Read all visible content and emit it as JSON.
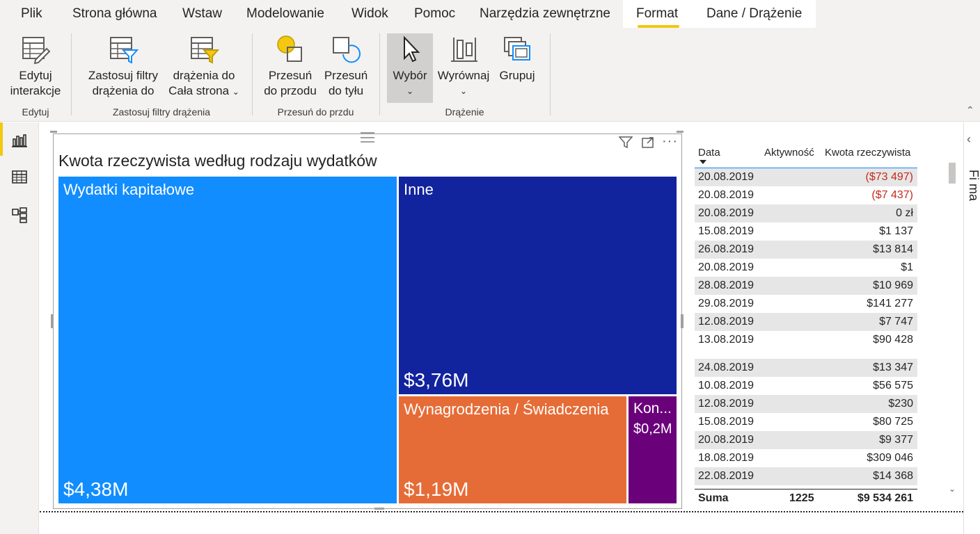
{
  "menu": {
    "tabs": [
      "Plik",
      "Strona główna",
      "Wstaw",
      "Modelowanie",
      "Widok",
      "Pomoc",
      "Narzędzia zewnętrzne",
      "Format",
      "Dane / Drążenie"
    ],
    "active": "Format"
  },
  "ribbon": {
    "edit_interactions": [
      "Edytuj",
      "interakcje"
    ],
    "apply_filters": [
      "Zastosuj filtry",
      "drążenia do"
    ],
    "drill_whole_page": [
      "drążenia do",
      "Cała strona"
    ],
    "bring_forward": [
      "Przesuń",
      "do przodu"
    ],
    "send_backward": [
      "Przesuń",
      "do tyłu"
    ],
    "selection": "Wybór",
    "align": "Wyrównaj",
    "group": "Grupuj",
    "groups": {
      "edit": "Edytuj",
      "apply_drill_filters": "Zastosuj filtry drążenia",
      "move": "Przesuń do przdu",
      "drill": "Drążenie"
    }
  },
  "treemap": {
    "title": "Kwota rzeczywista według rodzaju wydatków",
    "tiles": [
      {
        "label": "Wydatki kapitałowe",
        "value": "$4,38M",
        "color": "#118dff"
      },
      {
        "label": "Inne",
        "value": "$3,76M",
        "color": "#12239e"
      },
      {
        "label": "Wynagrodzenia / Świadczenia",
        "value": "$1,19M",
        "color": "#e66c37"
      },
      {
        "label": "Kon...",
        "value": "$0,2M",
        "color": "#6b007b"
      }
    ]
  },
  "table": {
    "headers": {
      "date": "Data",
      "activity": "Aktywność",
      "amount": "Kwota rzeczywista"
    },
    "rows": [
      {
        "date": "20.08.2019",
        "amount": "($73 497)",
        "negative": true
      },
      {
        "date": "20.08.2019",
        "amount": "($7 437)",
        "negative": true
      },
      {
        "date": "20.08.2019",
        "amount": "0 zł"
      },
      {
        "date": "15.08.2019",
        "amount": "$1 137"
      },
      {
        "date": "26.08.2019",
        "amount": "$13 814"
      },
      {
        "date": "20.08.2019",
        "amount": "$1"
      },
      {
        "date": "28.08.2019",
        "amount": "$10 969"
      },
      {
        "date": "29.08.2019",
        "amount": "$141 277"
      },
      {
        "date": "12.08.2019",
        "amount": "$7 747"
      },
      {
        "date": "13.08.2019",
        "amount": "$90 428"
      },
      {
        "date": "24.08.2019",
        "amount": "$13 347"
      },
      {
        "date": "10.08.2019",
        "amount": "$56 575"
      },
      {
        "date": "12.08.2019",
        "amount": "$230"
      },
      {
        "date": "15.08.2019",
        "amount": "$80 725"
      },
      {
        "date": "20.08.2019",
        "amount": "$9 377"
      },
      {
        "date": "18.08.2019",
        "amount": "$309 046"
      },
      {
        "date": "22.08.2019",
        "amount": "$14 368"
      }
    ],
    "total": {
      "label": "Suma",
      "activity": "1225",
      "amount": "$9 534 261"
    }
  },
  "right_panel": {
    "partial_text": "Fi ma"
  }
}
